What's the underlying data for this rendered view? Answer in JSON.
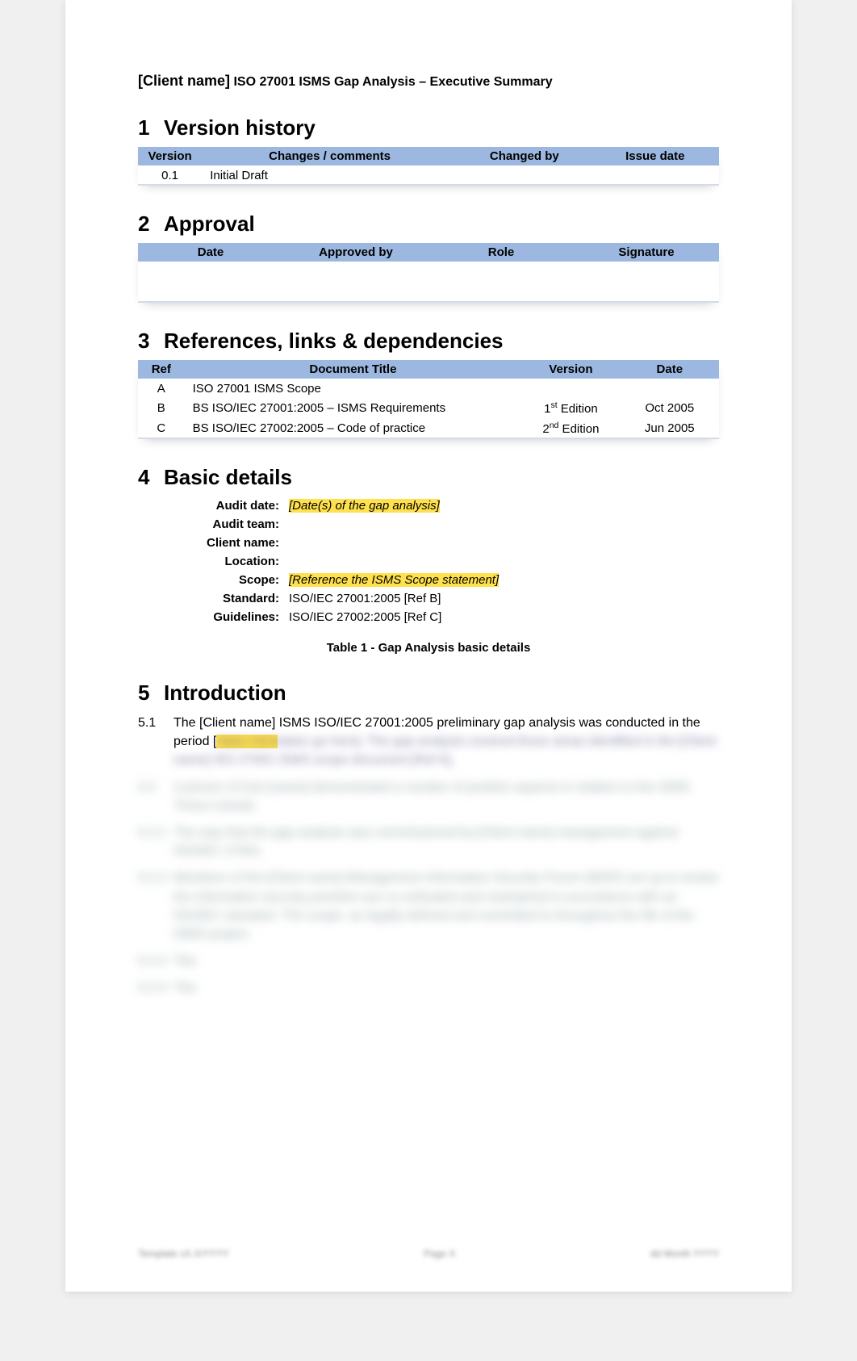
{
  "header": {
    "client": "[Client name]",
    "subtitle": "ISO 27001 ISMS Gap Analysis – Executive Summary"
  },
  "sections": {
    "s1": {
      "num": "1",
      "title": "Version history"
    },
    "s2": {
      "num": "2",
      "title": "Approval"
    },
    "s3": {
      "num": "3",
      "title": "References, links & dependencies"
    },
    "s4": {
      "num": "4",
      "title": "Basic details"
    },
    "s5": {
      "num": "5",
      "title": "Introduction"
    }
  },
  "version_history": {
    "headers": {
      "version": "Version",
      "changes": "Changes / comments",
      "changed_by": "Changed by",
      "issue_date": "Issue date"
    },
    "rows": [
      {
        "version": "0.1",
        "changes": "Initial Draft",
        "changed_by": "",
        "issue_date": ""
      }
    ]
  },
  "approval": {
    "headers": {
      "date": "Date",
      "approved_by": "Approved by",
      "role": "Role",
      "signature": "Signature"
    }
  },
  "references": {
    "headers": {
      "ref": "Ref",
      "title": "Document Title",
      "version": "Version",
      "date": "Date"
    },
    "rows": [
      {
        "ref": "A",
        "title": "ISO 27001 ISMS Scope",
        "version": "",
        "date": ""
      },
      {
        "ref": "B",
        "title": "BS ISO/IEC 27001:2005 – ISMS Requirements",
        "version_pre": "1",
        "version_ord": "st",
        "version_post": " Edition",
        "date": "Oct 2005"
      },
      {
        "ref": "C",
        "title": "BS ISO/IEC 27002:2005 – Code of practice",
        "version_pre": "2",
        "version_ord": "nd",
        "version_post": " Edition",
        "date": "Jun 2005"
      }
    ]
  },
  "basic_details": {
    "rows": {
      "audit_date": {
        "label": "Audit date:",
        "value": "[Date(s) of the gap analysis]",
        "highlight": true
      },
      "audit_team": {
        "label": "Audit team:",
        "value": ""
      },
      "client_name": {
        "label": "Client name:",
        "value": ""
      },
      "location": {
        "label": "Location:",
        "value": ""
      },
      "scope": {
        "label": "Scope:",
        "value": "[Reference the ISMS Scope statement]",
        "highlight": true
      },
      "standard": {
        "label": "Standard:",
        "value": "ISO/IEC 27001:2005 [Ref B]"
      },
      "guidelines": {
        "label": "Guidelines:",
        "value": "ISO/IEC 27002:2005 [Ref C]"
      }
    },
    "caption": "Table 1 - Gap Analysis basic details"
  },
  "introduction": {
    "p1_num": "5.1",
    "p1_text_visible": "The [Client name] ISMS ISO/IEC 27001:2005 preliminary gap analysis was conducted in the period [",
    "p1_text_blurred": "dates go here]. The gap analysis covered those areas identified in the [Client name] ISO 27001 ISMS scope document [Ref A].",
    "blurred": [
      "A picture of how [name] demonstrated a number of positive aspects in relation to the ISMS. These include:",
      "The way that the gap analysis was commissioned by [Client name] management against ISO/IEC 27001.",
      "Members of the [Client name] Management Information Security Forum (MISF) set up to review the information security priorities are co-ordinated and maintained in accordance with an ISO/IEC standard. The scope, as legally defined and committed to throughout the life of the ISMS project.",
      "Tba",
      "Tba"
    ]
  },
  "footer": {
    "left": "Template vX.X/YYYY",
    "center": "Page X",
    "right": "dd Month YYYY"
  }
}
